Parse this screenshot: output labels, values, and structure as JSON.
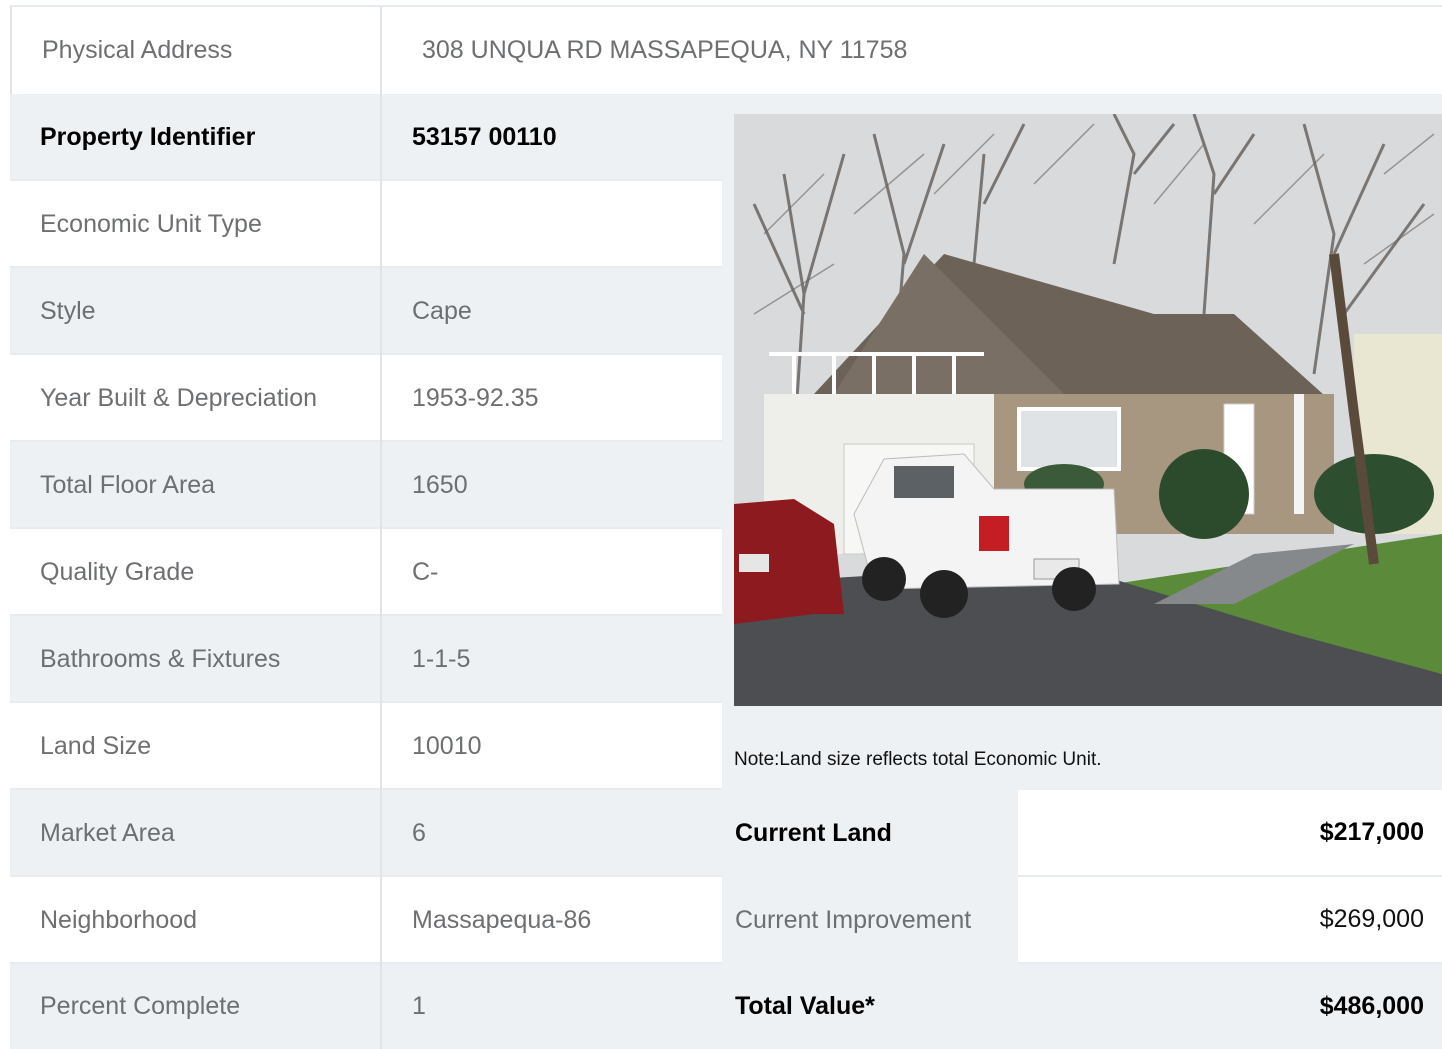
{
  "address": {
    "label": "Physical Address",
    "value": "308  UNQUA RD  MASSAPEQUA, NY  11758"
  },
  "rows": [
    {
      "label": "Property Identifier",
      "value": "53157  00110"
    },
    {
      "label": "Economic Unit Type",
      "value": ""
    },
    {
      "label": "Style",
      "value": "Cape"
    },
    {
      "label": "Year Built & Depreciation",
      "value": "1953-92.35"
    },
    {
      "label": "Total Floor Area",
      "value": "1650"
    },
    {
      "label": "Quality Grade",
      "value": "C-"
    },
    {
      "label": "Bathrooms & Fixtures",
      "value": "1-1-5"
    },
    {
      "label": "Land Size",
      "value": "10010"
    },
    {
      "label": "Market Area",
      "value": "6"
    },
    {
      "label": "Neighborhood",
      "value": "Massapequa-86"
    },
    {
      "label": "Percent Complete",
      "value": "1"
    }
  ],
  "note": "Note:Land size reflects total Economic Unit.",
  "values": [
    {
      "label": "Current Land",
      "value": "$217,000"
    },
    {
      "label": "Current Improvement",
      "value": "$269,000"
    },
    {
      "label": "Total Value*",
      "value": "$486,000"
    }
  ],
  "colors": {
    "row_gray": "#edf1f4",
    "text_gray": "#6d6f71",
    "border": "#e0e4e8"
  }
}
